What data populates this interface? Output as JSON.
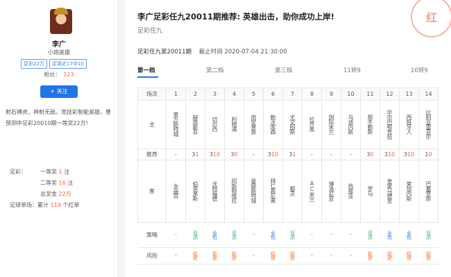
{
  "profile": {
    "name": "李广",
    "title": "小炮英雄",
    "tags": [
      "足彩22万",
      "足球近17中10"
    ],
    "fans_label": "粉丝：",
    "fans_count": "123",
    "follow_label": "+ 关注",
    "intro": "射石搏虎，神射无敌。竞技彩智能英雄，曾预测中足彩20010期一等奖22万!",
    "awards": {
      "zucai_label": "足彩：",
      "first_prize": "一等奖",
      "first_count": "1",
      "second_prize": "二等奖",
      "second_count": "16",
      "total_prize_label": "总奖金",
      "total_prize": "22万",
      "unit_zhu": "注",
      "single_label": "足球单场：",
      "cumulative": "累计",
      "red_count": "119",
      "red_unit": "个红单"
    }
  },
  "article": {
    "title": "李广足彩任九20011期推荐: 英雄出击，助你成功上岸!",
    "subtitle": "足彩任九",
    "stamp_char": "红",
    "issue": "足彩任九第20011期",
    "deadline": "截止时间 2020-07-04 21:30:00"
  },
  "tabs": [
    "第一档",
    "第二档",
    "第三档",
    "11转9",
    "10转9"
  ],
  "table": {
    "labels": {
      "match": "场次",
      "home": "主",
      "rec": "推荐",
      "away": "客",
      "strategy": "策略",
      "risk": "风险"
    },
    "numbers": [
      "1",
      "2",
      "3",
      "4",
      "5",
      "6",
      "7",
      "8",
      "9",
      "10",
      "11",
      "12",
      "13",
      "14"
    ],
    "home": [
      "莱万斯特城",
      "赫塔斯菲",
      "切尔西",
      "利物浦",
      "南安普敦",
      "勒沃库森",
      "尤文图斯",
      "拉齐奥",
      "国际米兰",
      "乌迪内斯",
      "那不勒斯",
      "毕尔巴鄂竞技",
      "西班牙人",
      "比利亚雷亚尔"
    ],
    "rec_prefix": [
      "-",
      "3",
      "3",
      "3",
      "-",
      "3",
      "3",
      "-",
      "-",
      "-",
      "3",
      "3",
      "3",
      "1"
    ],
    "rec_suffix": [
      "",
      "1",
      "10",
      "0",
      "",
      "10",
      "1",
      "",
      "",
      "",
      "0",
      "10",
      "10",
      "0"
    ],
    "away": [
      "水晶宫",
      "伯恩茅斯",
      "沃特福德",
      "阿斯顿维拉",
      "曼联斯特城",
      "拜仁慕尼黑",
      "都灵",
      "AC米兰",
      "博洛尼亚",
      "热那亚",
      "罗马",
      "皇家马德里",
      "莱加内斯",
      "巴塞罗那"
    ],
    "strategy": [
      "-",
      "双选",
      "全包",
      "双选",
      "-",
      "全包",
      "双选",
      "-",
      "-",
      "-",
      "双选",
      "全包",
      "全包",
      "双选"
    ],
    "strategy_color": [
      "",
      "green",
      "blue",
      "green",
      "",
      "blue",
      "green",
      "",
      "",
      "",
      "green",
      "blue",
      "blue",
      "green"
    ],
    "risk": [
      "-",
      "稳健",
      "稳健",
      "稳健",
      "-",
      "稳健",
      "稳健",
      "-",
      "-",
      "-",
      "稳健",
      "稳健",
      "稳健",
      "稳健"
    ]
  }
}
